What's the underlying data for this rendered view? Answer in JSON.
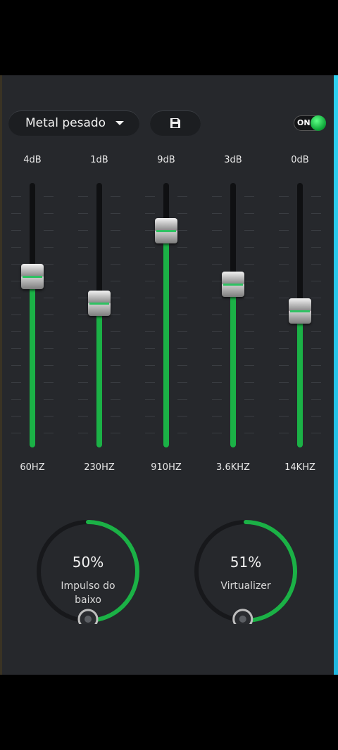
{
  "header": {
    "preset_label": "Metal pesado",
    "save_icon": "save-icon",
    "toggle_label": "ON",
    "toggle_on": true
  },
  "bands": [
    {
      "gain": "4dB",
      "freq": "60HZ",
      "level": 0.64
    },
    {
      "gain": "1dB",
      "freq": "230HZ",
      "level": 0.54
    },
    {
      "gain": "9dB",
      "freq": "910HZ",
      "level": 0.81
    },
    {
      "gain": "3dB",
      "freq": "3.6KHZ",
      "level": 0.61
    },
    {
      "gain": "0dB",
      "freq": "14KHZ",
      "level": 0.51
    }
  ],
  "knobs": [
    {
      "value": "50%",
      "label": "Impulso do baixo",
      "fraction": 0.5
    },
    {
      "value": "51%",
      "label": "Virtualizer",
      "fraction": 0.51
    }
  ],
  "colors": {
    "accent": "#1bb146",
    "panel": "#26282c",
    "track": "#0f1012",
    "edge": "#2fd1f0"
  }
}
